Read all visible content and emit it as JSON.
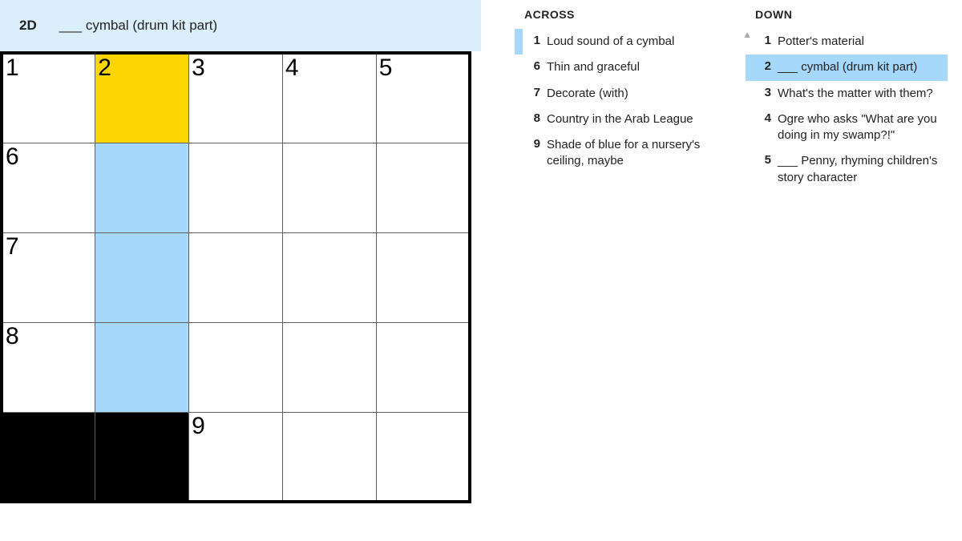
{
  "clue_bar": {
    "id": "2D",
    "text": "___ cymbal (drum kit part)"
  },
  "grid": {
    "rows": [
      [
        {
          "num": "1",
          "state": "normal"
        },
        {
          "num": "2",
          "state": "active"
        },
        {
          "num": "3",
          "state": "normal"
        },
        {
          "num": "4",
          "state": "normal"
        },
        {
          "num": "5",
          "state": "normal"
        }
      ],
      [
        {
          "num": "6",
          "state": "normal"
        },
        {
          "num": "",
          "state": "word"
        },
        {
          "num": "",
          "state": "normal"
        },
        {
          "num": "",
          "state": "normal"
        },
        {
          "num": "",
          "state": "normal"
        }
      ],
      [
        {
          "num": "7",
          "state": "normal"
        },
        {
          "num": "",
          "state": "word"
        },
        {
          "num": "",
          "state": "normal"
        },
        {
          "num": "",
          "state": "normal"
        },
        {
          "num": "",
          "state": "normal"
        }
      ],
      [
        {
          "num": "8",
          "state": "normal"
        },
        {
          "num": "",
          "state": "word"
        },
        {
          "num": "",
          "state": "normal"
        },
        {
          "num": "",
          "state": "normal"
        },
        {
          "num": "",
          "state": "normal"
        }
      ],
      [
        {
          "num": "",
          "state": "black"
        },
        {
          "num": "",
          "state": "black"
        },
        {
          "num": "9",
          "state": "normal"
        },
        {
          "num": "",
          "state": "normal"
        },
        {
          "num": "",
          "state": "normal"
        }
      ]
    ]
  },
  "across": {
    "heading": "ACROSS",
    "clues": [
      {
        "num": "1",
        "text": "Loud sound of a cymbal",
        "state": "related"
      },
      {
        "num": "6",
        "text": "Thin and graceful",
        "state": ""
      },
      {
        "num": "7",
        "text": "Decorate (with)",
        "state": ""
      },
      {
        "num": "8",
        "text": "Country in the Arab League",
        "state": ""
      },
      {
        "num": "9",
        "text": "Shade of blue for a nursery's ceiling, maybe",
        "state": ""
      }
    ]
  },
  "down": {
    "heading": "DOWN",
    "clues": [
      {
        "num": "1",
        "text": "Potter's material",
        "state": ""
      },
      {
        "num": "2",
        "text": "___ cymbal (drum kit part)",
        "state": "selected"
      },
      {
        "num": "3",
        "text": "What's the matter with them?",
        "state": ""
      },
      {
        "num": "4",
        "text": "Ogre who asks \"What are you doing in my swamp?!\"",
        "state": ""
      },
      {
        "num": "5",
        "text": "___ Penny, rhyming children's story character",
        "state": ""
      }
    ]
  },
  "scroll_indicator": "▲"
}
